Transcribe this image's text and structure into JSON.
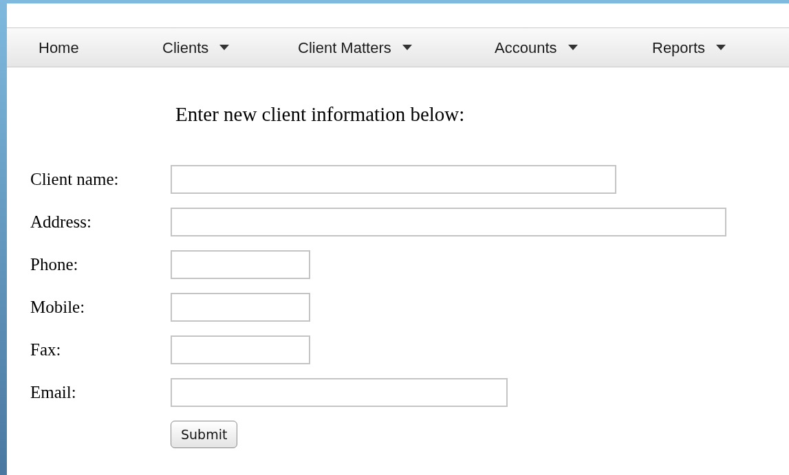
{
  "nav": [
    {
      "label": "Home",
      "has_menu": false
    },
    {
      "label": "Clients",
      "has_menu": true
    },
    {
      "label": "Client Matters",
      "has_menu": true
    },
    {
      "label": "Accounts",
      "has_menu": true
    },
    {
      "label": "Reports",
      "has_menu": true
    }
  ],
  "heading": "Enter new client information below:",
  "fields": [
    {
      "label": "Client name:"
    },
    {
      "label": "Address:"
    },
    {
      "label": "Phone:"
    },
    {
      "label": "Mobile:"
    },
    {
      "label": "Fax:"
    },
    {
      "label": "Email:"
    }
  ],
  "submit": "Submit"
}
